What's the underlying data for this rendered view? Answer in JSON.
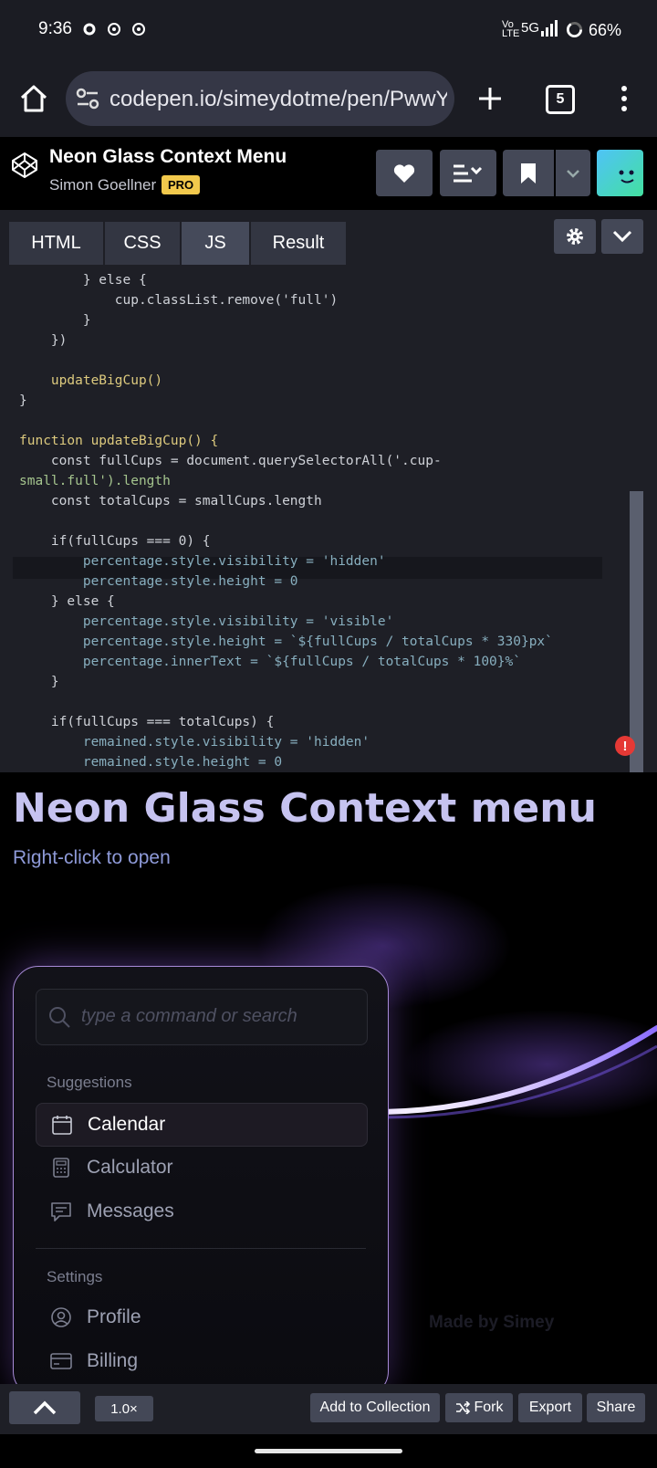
{
  "status_bar": {
    "time": "9:36",
    "network": "5G",
    "battery": "66%"
  },
  "browser": {
    "url": "codepen.io/simeydotme/pen/PwwY",
    "tab_count": "5"
  },
  "pen": {
    "title": "Neon Glass Context Menu",
    "author": "Simon Goellner",
    "badge": "PRO"
  },
  "editor_tabs": [
    {
      "label": "HTML"
    },
    {
      "label": "CSS"
    },
    {
      "label": "JS"
    },
    {
      "label": "Result"
    }
  ],
  "code_lines": [
    "        } else {",
    "            cup.classList.remove('full')",
    "        }",
    "    })",
    "",
    "    updateBigCup()",
    "}",
    "",
    "function updateBigCup() {",
    "    const fullCups = document.querySelectorAll('.cup-",
    "small.full').length",
    "    const totalCups = smallCups.length",
    "",
    "    if(fullCups === 0) {",
    "        percentage.style.visibility = 'hidden'",
    "        percentage.style.height = 0",
    "    } else {",
    "        percentage.style.visibility = 'visible'",
    "        percentage.style.height = `${fullCups / totalCups * 330}px`",
    "        percentage.innerText = `${fullCups / totalCups * 100}%`",
    "    }",
    "",
    "    if(fullCups === totalCups) {",
    "        remained.style.visibility = 'hidden'",
    "        remained.style.height = 0"
  ],
  "result": {
    "heading": "Neon Glass Context menu",
    "subheading": "Right-click to open",
    "search_placeholder": "type a command or search",
    "suggestions_label": "Suggestions",
    "suggestions": [
      {
        "label": "Calendar"
      },
      {
        "label": "Calculator"
      },
      {
        "label": "Messages"
      }
    ],
    "settings_label": "Settings",
    "settings": [
      {
        "label": "Profile"
      },
      {
        "label": "Billing"
      }
    ],
    "credit": "Made by Simey"
  },
  "bottom_bar": {
    "zoom": "1.0×",
    "add_to_collection": "Add to Collection",
    "fork": "Fork",
    "export": "Export",
    "share": "Share"
  },
  "colors": {
    "accent_pro": "#f2c94c",
    "neon": "#a88bd8",
    "code_bg": "#1e1f26"
  }
}
